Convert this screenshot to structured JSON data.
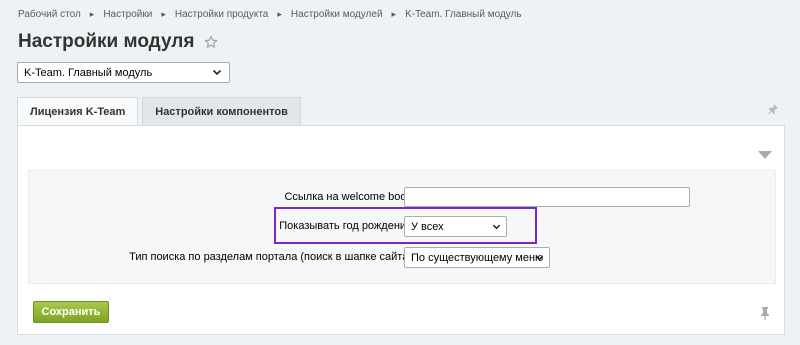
{
  "breadcrumb": {
    "items": [
      "Рабочий стол",
      "Настройки",
      "Настройки продукта",
      "Настройки модулей",
      "K-Team. Главный модуль"
    ],
    "separator": "▸"
  },
  "page": {
    "title": "Настройки модуля",
    "star_icon": "star-outline-icon"
  },
  "module_select": {
    "value": "K-Team. Главный модуль",
    "icon": "chevron-down-icon"
  },
  "tabs": [
    {
      "label": "Лицензия K-Team",
      "active": true
    },
    {
      "label": "Настройки компонентов",
      "active": false
    }
  ],
  "form": {
    "welcome_book": {
      "label": "Ссылка на welcome book",
      "value": ""
    },
    "birth_year": {
      "label": "Показывать год рождения",
      "value": "У всех"
    },
    "search_type": {
      "label": "Тип поиска по разделам портала (поиск в шапке сайта)",
      "value": "По существующему меню"
    }
  },
  "actions": {
    "save_label": "Сохранить"
  },
  "colors": {
    "accent_green": "#8bb02d",
    "highlight_purple": "#7a26c9",
    "page_bg": "#eef2f4"
  }
}
